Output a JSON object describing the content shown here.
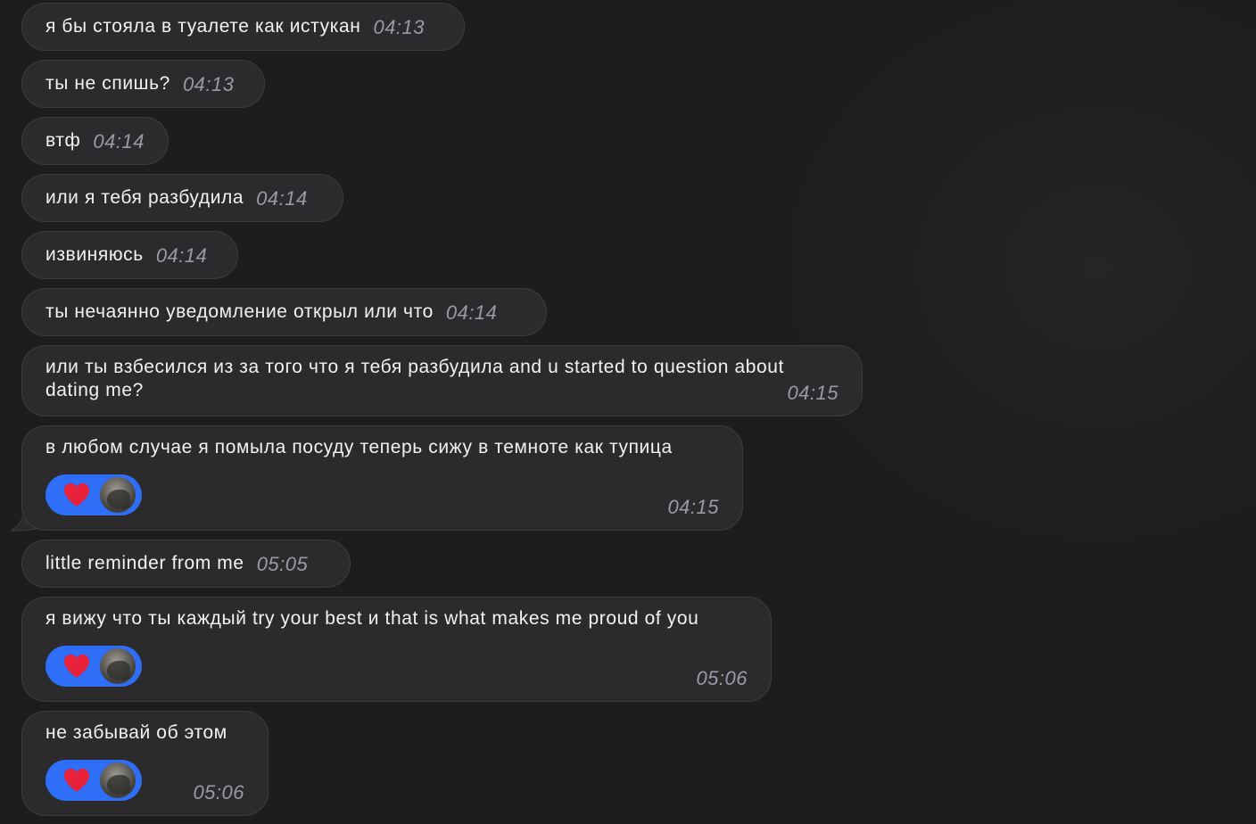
{
  "messages": [
    {
      "text": "я бы стояла в туалете как истукан",
      "time": "04:13"
    },
    {
      "text": "ты не спишь?",
      "time": "04:13"
    },
    {
      "text": "втф",
      "time": "04:14"
    },
    {
      "text": "или я тебя разбудила",
      "time": "04:14"
    },
    {
      "text": "извиняюсь",
      "time": "04:14"
    },
    {
      "text": "ты нечаянно уведомление открыл или что",
      "time": "04:14"
    },
    {
      "text_line1": "или ты взбесился из за того что я тебя разбудила and u started to question about",
      "text_line2": "dating me?",
      "time": "04:15"
    },
    {
      "text": "в любом случае я помыла посуду теперь сижу в темноте как тупица",
      "time": "04:15",
      "reaction": "red-heart-icon"
    },
    {
      "text": "little reminder from me",
      "time": "05:05"
    },
    {
      "text": "я вижу что ты каждый try your best и that is what makes me proud of you",
      "time": "05:06",
      "reaction": "red-heart-icon"
    },
    {
      "text": "не забывай об этом",
      "time": "05:06",
      "reaction": "red-heart-icon"
    }
  ],
  "colors": {
    "background": "#1c1d1f",
    "bubble": "#2b2b2d",
    "bubble_border": "#3d3d40",
    "reaction_pill": "#2f6ef6",
    "heart": "#e8223a",
    "time": "#9a9aa6"
  }
}
